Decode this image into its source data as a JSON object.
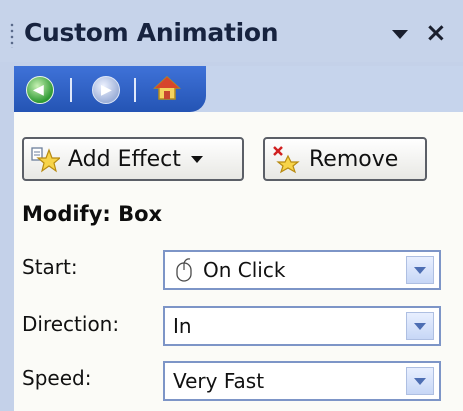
{
  "title_bar": {
    "title": "Custom Animation",
    "dropdown_icon": "chevron-down-icon",
    "close_label": "×"
  },
  "nav": {
    "back_icon": "back-arrow-icon",
    "forward_icon": "forward-arrow-icon",
    "home_icon": "home-icon"
  },
  "toolbar": {
    "add_effect_label": "Add Effect",
    "remove_label": "Remove"
  },
  "modify": {
    "title": "Modify: Box",
    "start": {
      "label": "Start:",
      "value": "On Click"
    },
    "direction": {
      "label": "Direction:",
      "value": "In"
    },
    "speed": {
      "label": "Speed:",
      "value": "Very Fast"
    }
  },
  "colors": {
    "pane_bg": "#c4d1e9",
    "nav_tab": "#2f5fc4",
    "panel_bg": "#fbfbf7",
    "select_border": "#7d95c7"
  }
}
